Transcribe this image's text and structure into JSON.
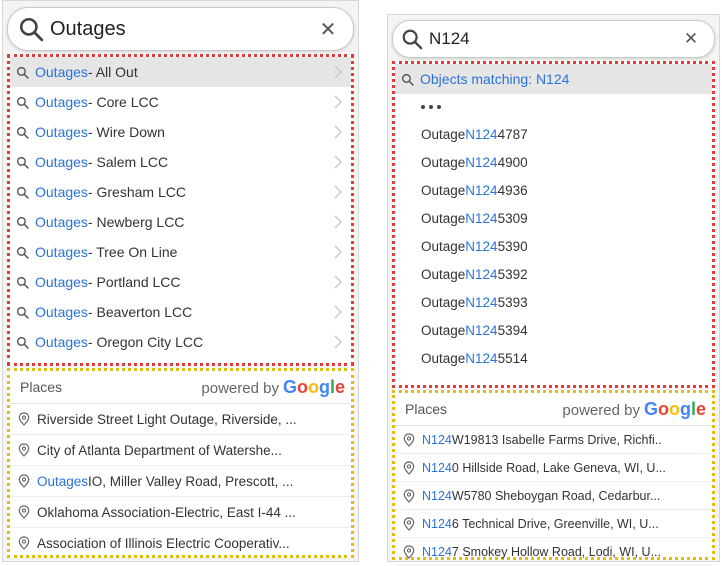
{
  "left": {
    "search_value": "Outages",
    "suggestions": [
      {
        "highlight": "Outages",
        "rest": " - All Out"
      },
      {
        "highlight": "Outages",
        "rest": " - Core LCC"
      },
      {
        "highlight": "Outages",
        "rest": " - Wire Down"
      },
      {
        "highlight": "Outages",
        "rest": " - Salem LCC"
      },
      {
        "highlight": "Outages",
        "rest": " - Gresham LCC"
      },
      {
        "highlight": "Outages",
        "rest": " - Newberg LCC"
      },
      {
        "highlight": "Outages",
        "rest": " - Tree On Line"
      },
      {
        "highlight": "Outages",
        "rest": " - Portland LCC"
      },
      {
        "highlight": "Outages",
        "rest": " - Beaverton LCC"
      },
      {
        "highlight": "Outages",
        "rest": " - Oregon City LCC"
      }
    ],
    "places_label": "Places",
    "powered_by": "powered by",
    "google": "Google",
    "places": [
      {
        "highlight": "",
        "rest": "Riverside Street Light Outage, Riverside, ..."
      },
      {
        "highlight": "",
        "rest": "City of Atlanta Department of Watershe..."
      },
      {
        "highlight": "Outages",
        "rest": "IO, Miller Valley Road, Prescott, ..."
      },
      {
        "highlight": "",
        "rest": "Oklahoma Association-Electric, East I-44 ..."
      },
      {
        "highlight": "",
        "rest": "Association of Illinois Electric Cooperativ..."
      }
    ]
  },
  "right": {
    "search_value": "N124",
    "objects_header": "Objects matching: N124",
    "objects": [
      {
        "prefix": "Outage ",
        "highlight": "N124",
        "rest": "4787"
      },
      {
        "prefix": "Outage ",
        "highlight": "N124",
        "rest": "4900"
      },
      {
        "prefix": "Outage ",
        "highlight": "N124",
        "rest": "4936"
      },
      {
        "prefix": "Outage ",
        "highlight": "N124",
        "rest": "5309"
      },
      {
        "prefix": "Outage ",
        "highlight": "N124",
        "rest": "5390"
      },
      {
        "prefix": "Outage ",
        "highlight": "N124",
        "rest": "5392"
      },
      {
        "prefix": "Outage ",
        "highlight": "N124",
        "rest": "5393"
      },
      {
        "prefix": "Outage ",
        "highlight": "N124",
        "rest": "5394"
      },
      {
        "prefix": "Outage ",
        "highlight": "N124",
        "rest": "5514"
      }
    ],
    "places_label": "Places",
    "powered_by": "powered by",
    "google": "Google",
    "places": [
      {
        "highlight": "N124",
        "rest": "W19813 Isabelle Farms Drive, Richfi.."
      },
      {
        "highlight": "N124",
        "rest": "0 Hillside Road, Lake Geneva, WI, U..."
      },
      {
        "highlight": "N124",
        "rest": "W5780 Sheboygan Road, Cedarbur..."
      },
      {
        "highlight": "N124",
        "rest": "6 Technical Drive, Greenville, WI, U..."
      },
      {
        "highlight": "N124",
        "rest": "7 Smokey Hollow Road, Lodi, WI, U..."
      }
    ]
  },
  "icons": {
    "search": "search-icon",
    "clear": "close-icon",
    "chevron": "chevron-right-icon",
    "pin": "location-pin-icon"
  },
  "colors": {
    "highlight": "#2a73d8",
    "suggest_border": "#e23b3b",
    "places_border": "#e0bf12"
  }
}
